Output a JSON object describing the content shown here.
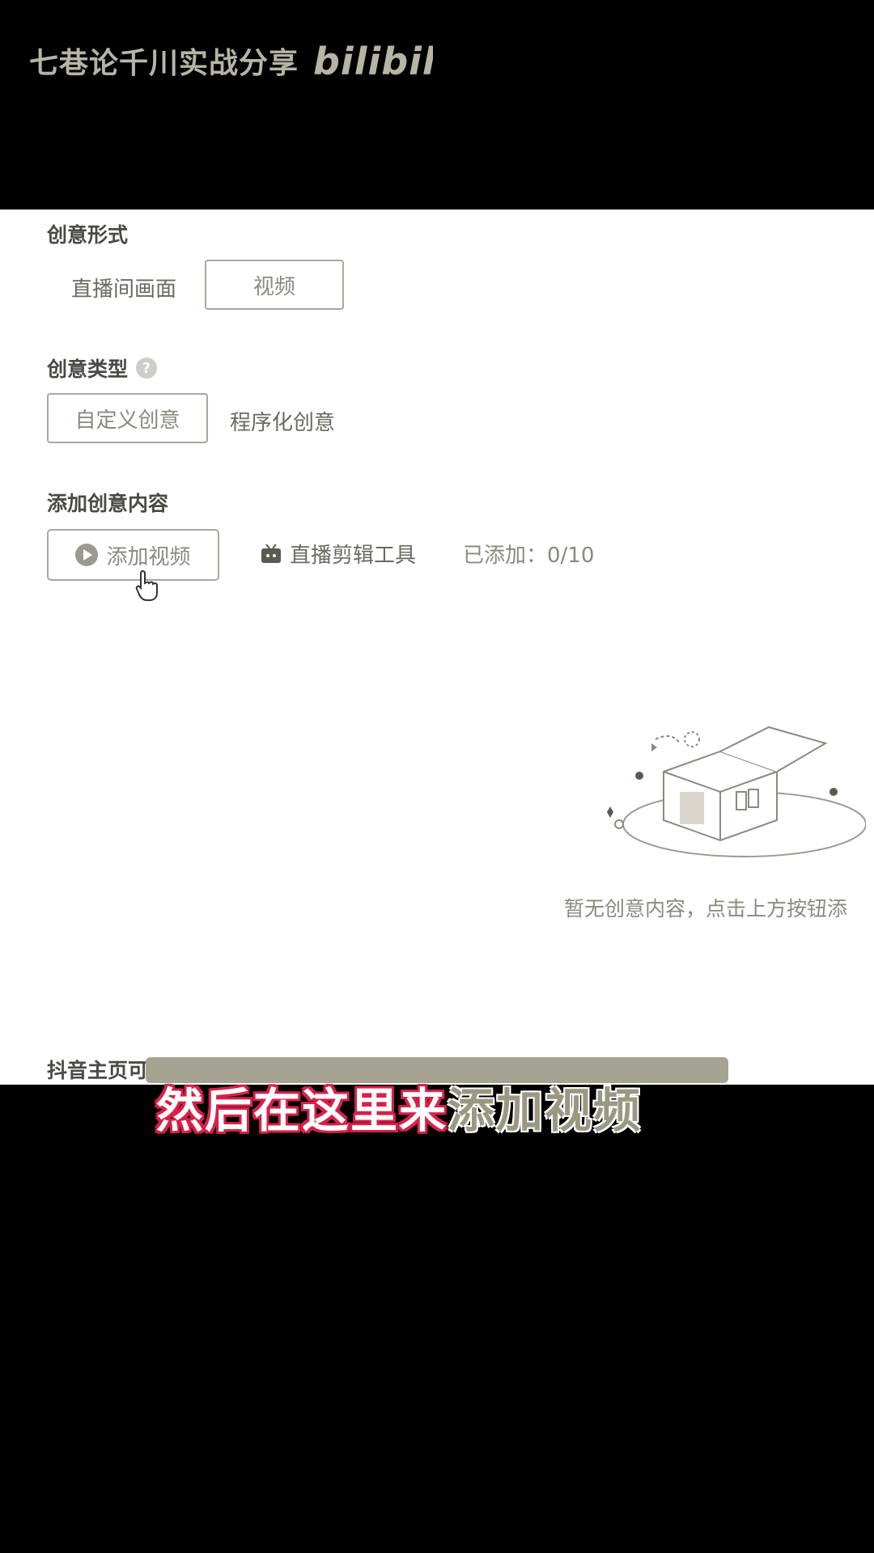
{
  "watermark": {
    "channel": "七巷论千川实战分享",
    "logo_text": "bilibili"
  },
  "creative_form": {
    "label": "创意形式",
    "options": [
      "直播间画面",
      "视频"
    ]
  },
  "creative_type": {
    "label": "创意类型",
    "help_icon": "?",
    "options": [
      "自定义创意",
      "程序化创意"
    ]
  },
  "creative_content": {
    "label": "添加创意内容",
    "add_video_label": "添加视频",
    "clip_tool_label": "直播剪辑工具",
    "added_count": "已添加：0/10"
  },
  "empty_state": {
    "text": "暂无创意内容，点击上方按钮添"
  },
  "visibility": {
    "label": "抖音主页可见性设置"
  },
  "subtitle": {
    "part1": "然后在这里来",
    "part2": "添加视频"
  },
  "icons": [
    "bilibili-logo",
    "help-icon",
    "play-icon",
    "tv-icon",
    "cursor-icon",
    "empty-box-illustration"
  ],
  "colors": {
    "accent_subtitle": "#d8204a",
    "muted_text": "#8a8a7e"
  }
}
